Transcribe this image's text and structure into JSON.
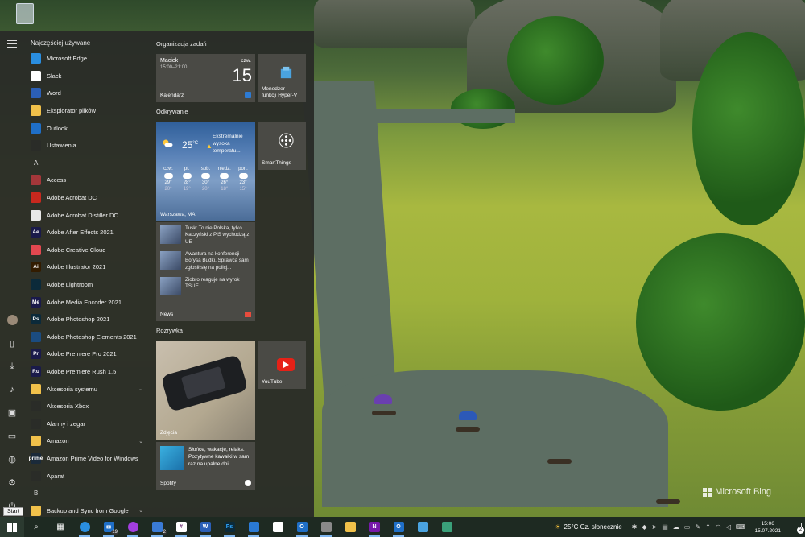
{
  "start_menu": {
    "most_used_header": "Najczęściej używane",
    "most_used": [
      {
        "label": "Microsoft Edge",
        "icon": "edge-icon",
        "color": "#2a8ee0"
      },
      {
        "label": "Slack",
        "icon": "slack-icon",
        "color": "#ffffff"
      },
      {
        "label": "Word",
        "icon": "word-icon",
        "color": "#2b5fb6"
      },
      {
        "label": "Eksplorator plików",
        "icon": "folder-icon",
        "color": "#f1c14a"
      },
      {
        "label": "Outlook",
        "icon": "outlook-icon",
        "color": "#1f6fc7"
      },
      {
        "label": "Ustawienia",
        "icon": "gear-icon",
        "color": "#2a2c28"
      }
    ],
    "letter_a": "A",
    "apps_a": [
      {
        "label": "Access",
        "icon": "access-icon",
        "color": "#a4373a",
        "glyph": ""
      },
      {
        "label": "Adobe Acrobat DC",
        "icon": "acrobat-icon",
        "color": "#c8281e",
        "glyph": ""
      },
      {
        "label": "Adobe Acrobat Distiller DC",
        "icon": "distiller-icon",
        "color": "#e8e8e8",
        "glyph": ""
      },
      {
        "label": "Adobe After Effects 2021",
        "icon": "after-effects-icon",
        "color": "#1a1a4a",
        "glyph": "Ae"
      },
      {
        "label": "Adobe Creative Cloud",
        "icon": "creative-cloud-icon",
        "color": "#e34850",
        "glyph": ""
      },
      {
        "label": "Adobe Illustrator 2021",
        "icon": "illustrator-icon",
        "color": "#331c00",
        "glyph": "Ai"
      },
      {
        "label": "Adobe Lightroom",
        "icon": "lightroom-icon",
        "color": "#0b2a3a",
        "glyph": ""
      },
      {
        "label": "Adobe Media Encoder 2021",
        "icon": "media-encoder-icon",
        "color": "#1a1a4a",
        "glyph": "Me"
      },
      {
        "label": "Adobe Photoshop 2021",
        "icon": "photoshop-icon",
        "color": "#0b2a3a",
        "glyph": "Ps"
      },
      {
        "label": "Adobe Photoshop Elements 2021",
        "icon": "photoshop-elements-icon",
        "color": "#1b4c80",
        "glyph": ""
      },
      {
        "label": "Adobe Premiere Pro 2021",
        "icon": "premiere-pro-icon",
        "color": "#1a1a4a",
        "glyph": "Pr"
      },
      {
        "label": "Adobe Premiere Rush 1.5",
        "icon": "premiere-rush-icon",
        "color": "#1a1a4a",
        "glyph": "Ru"
      },
      {
        "label": "Akcesoria systemu",
        "icon": "folder-icon",
        "color": "#f1c14a",
        "glyph": "",
        "expand": true
      },
      {
        "label": "Akcesoria Xbox",
        "icon": "xbox-icon",
        "color": "#2a2c28",
        "glyph": ""
      },
      {
        "label": "Alarmy i zegar",
        "icon": "clock-icon",
        "color": "#2a2c28",
        "glyph": ""
      },
      {
        "label": "Amazon",
        "icon": "folder-icon",
        "color": "#f1c14a",
        "glyph": "",
        "expand": true
      },
      {
        "label": "Amazon Prime Video for Windows",
        "icon": "prime-video-icon",
        "color": "#1a2a3a",
        "glyph": "prime"
      },
      {
        "label": "Aparat",
        "icon": "camera-icon",
        "color": "#2a2c28",
        "glyph": ""
      }
    ],
    "letter_b": "B",
    "apps_b": [
      {
        "label": "Backup and Sync from Google",
        "icon": "folder-icon",
        "color": "#f1c14a",
        "expand": true
      }
    ],
    "tiles": {
      "group_1": "Organizacja zadań",
      "calendar": {
        "who": "Maciek",
        "time": "15:00–21:00",
        "dow": "czw.",
        "day": "15",
        "label": "Kalendarz"
      },
      "hyperv": {
        "label_line1": "Menedżer",
        "label_line2": "funkcji Hyper-V"
      },
      "group_2": "Odkrywanie",
      "weather": {
        "temp": "25",
        "unit": "°C",
        "alert": "Ekstremalnie wysoka temperatu...",
        "days": [
          {
            "d": "czw.",
            "hi": "29°",
            "lo": "20°"
          },
          {
            "d": "pt.",
            "hi": "28°",
            "lo": "19°"
          },
          {
            "d": "sob.",
            "hi": "30°",
            "lo": "20°"
          },
          {
            "d": "niedz.",
            "hi": "26°",
            "lo": "18°"
          },
          {
            "d": "pon.",
            "hi": "23°",
            "lo": "15°"
          }
        ],
        "location": "Warszawa, MA"
      },
      "smartthings": {
        "label": "SmartThings"
      },
      "news": {
        "items": [
          "Tusk: To nie Polska, tylko Kaczyński z PiS wychodzą z UE",
          "Awantura na konferencji Borysa Budki. Sprawca sam zgłosił się na policj...",
          "Ziobro reaguje na wyrok TSUE"
        ],
        "label": "News"
      },
      "group_3": "Rozrywka",
      "youtube": {
        "label": "YouTube"
      },
      "photos": {
        "label": "Zdjęcia"
      },
      "spotify": {
        "text": "Słońce, wakacje, relaks. Pozytywne kawałki w sam raz na upalne dni.",
        "label": "Spotify"
      }
    }
  },
  "taskbar": {
    "start_tooltip": "Start",
    "weather_text": "25°C  Cz. słonecznie",
    "time": "15:06",
    "date": "15.07.2021",
    "notification_count": "2",
    "mail_badge": "19",
    "app_badge": "2"
  },
  "desktop": {
    "watermark": "Microsoft Bing"
  }
}
